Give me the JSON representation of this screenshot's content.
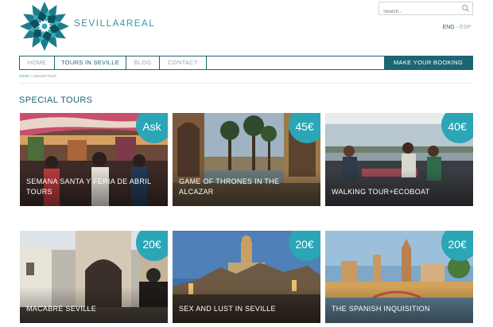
{
  "brand": {
    "name_part1": "SEVILLA",
    "name_part2": "4REAL"
  },
  "search": {
    "placeholder": "Search..."
  },
  "lang": {
    "active": "ENG",
    "separator": "-",
    "other": "ESP"
  },
  "nav": {
    "items": [
      {
        "label": "HOME",
        "active": false
      },
      {
        "label": "TOURS IN SEVILLE",
        "active": true
      },
      {
        "label": "BLOG",
        "active": false
      },
      {
        "label": "CONTACT",
        "active": false
      }
    ],
    "booking_label": "MAKE YOUR BOOKING"
  },
  "breadcrumb": {
    "home": "Home",
    "separator": "»",
    "current": "Special Tours"
  },
  "page_title": "SPECIAL TOURS",
  "tours": [
    {
      "title": "SEMANA SANTA Y FERIA DE ABRIL TOURS",
      "price": "Ask"
    },
    {
      "title": "GAME OF THRONES IN THE ALCAZAR",
      "price": "45€"
    },
    {
      "title": "WALKING TOUR+ECOBOAT",
      "price": "40€"
    },
    {
      "title": "MACABRE SEVILLE",
      "price": "20€"
    },
    {
      "title": "SEX AND LUST IN SEVILLE",
      "price": "20€"
    },
    {
      "title": "THE SPANISH INQUISITION",
      "price": "20€"
    }
  ],
  "colors": {
    "primary": "#1c6673",
    "accent": "#2aa6b6",
    "muted": "#9aa6a8"
  }
}
